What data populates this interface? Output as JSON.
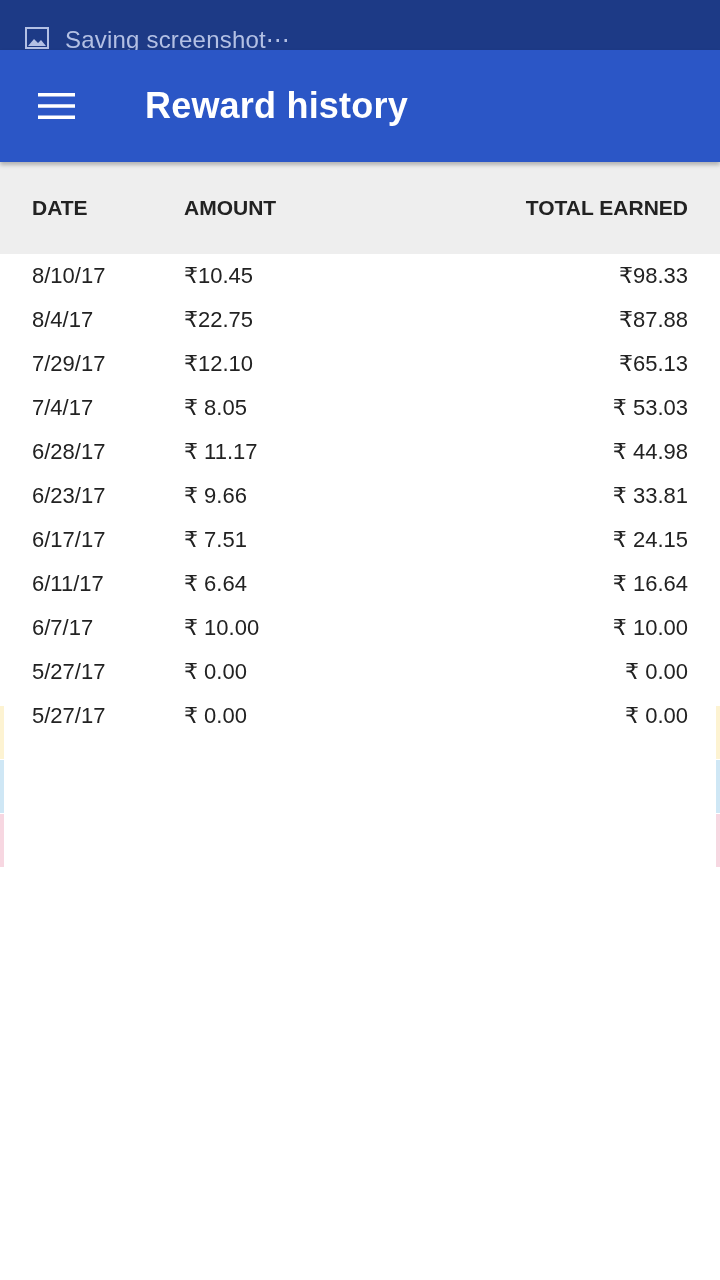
{
  "status_bar": {
    "notification": "Saving screenshot⋯"
  },
  "app_bar": {
    "title": "Reward history"
  },
  "table": {
    "columns": [
      "DATE",
      "AMOUNT",
      "TOTAL EARNED"
    ],
    "rows": [
      [
        "8/10/17",
        "₹10.45",
        "₹98.33"
      ],
      [
        "8/4/17",
        "₹22.75",
        "₹87.88"
      ],
      [
        "7/29/17",
        "₹12.10",
        "₹65.13"
      ],
      [
        "7/4/17",
        "₹ 8.05",
        "₹ 53.03"
      ],
      [
        "6/28/17",
        "₹ 11.17",
        "₹ 44.98"
      ],
      [
        "6/23/17",
        "₹ 9.66",
        "₹ 33.81"
      ],
      [
        "6/17/17",
        "₹ 7.51",
        "₹ 24.15"
      ],
      [
        "6/11/17",
        "₹ 6.64",
        "₹ 16.64"
      ],
      [
        "6/7/17",
        "₹ 10.00",
        "₹ 10.00"
      ],
      [
        "5/27/17",
        "₹ 0.00",
        "₹ 0.00"
      ],
      [
        "5/27/17",
        "₹ 0.00",
        "₹ 0.00"
      ]
    ]
  }
}
